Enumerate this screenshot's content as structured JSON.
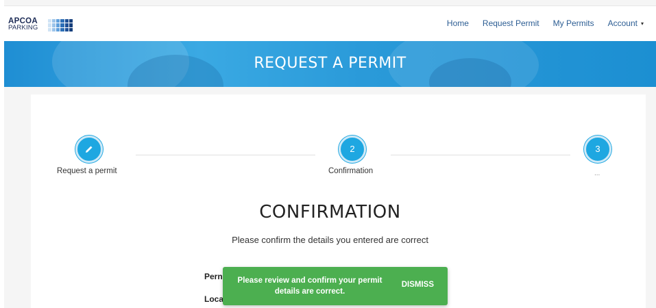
{
  "logo": {
    "line1": "APCOA",
    "line2": "PARKING",
    "blocks_color": "#2d6fb7"
  },
  "nav": {
    "items": [
      {
        "label": "Home"
      },
      {
        "label": "Request Permit"
      },
      {
        "label": "My Permits"
      },
      {
        "label": "Account"
      }
    ],
    "account_caret": "▾"
  },
  "banner": {
    "title": "REQUEST A PERMIT"
  },
  "stepper": {
    "steps": [
      {
        "icon": "pencil-icon",
        "label": "Request a permit",
        "done": true
      },
      {
        "number": "2",
        "label": "Confirmation"
      },
      {
        "number": "3",
        "label": "..."
      }
    ],
    "accent_color": "#1ea7e1"
  },
  "confirmation": {
    "title": "CONFIRMATION",
    "subtitle": "Please confirm the details you entered are correct",
    "fields": [
      {
        "label": "Pern"
      },
      {
        "label": "Loca"
      }
    ]
  },
  "toast": {
    "message": "Please review and confirm your permit details are correct.",
    "dismiss": "DISMISS",
    "color": "#4caf50"
  }
}
